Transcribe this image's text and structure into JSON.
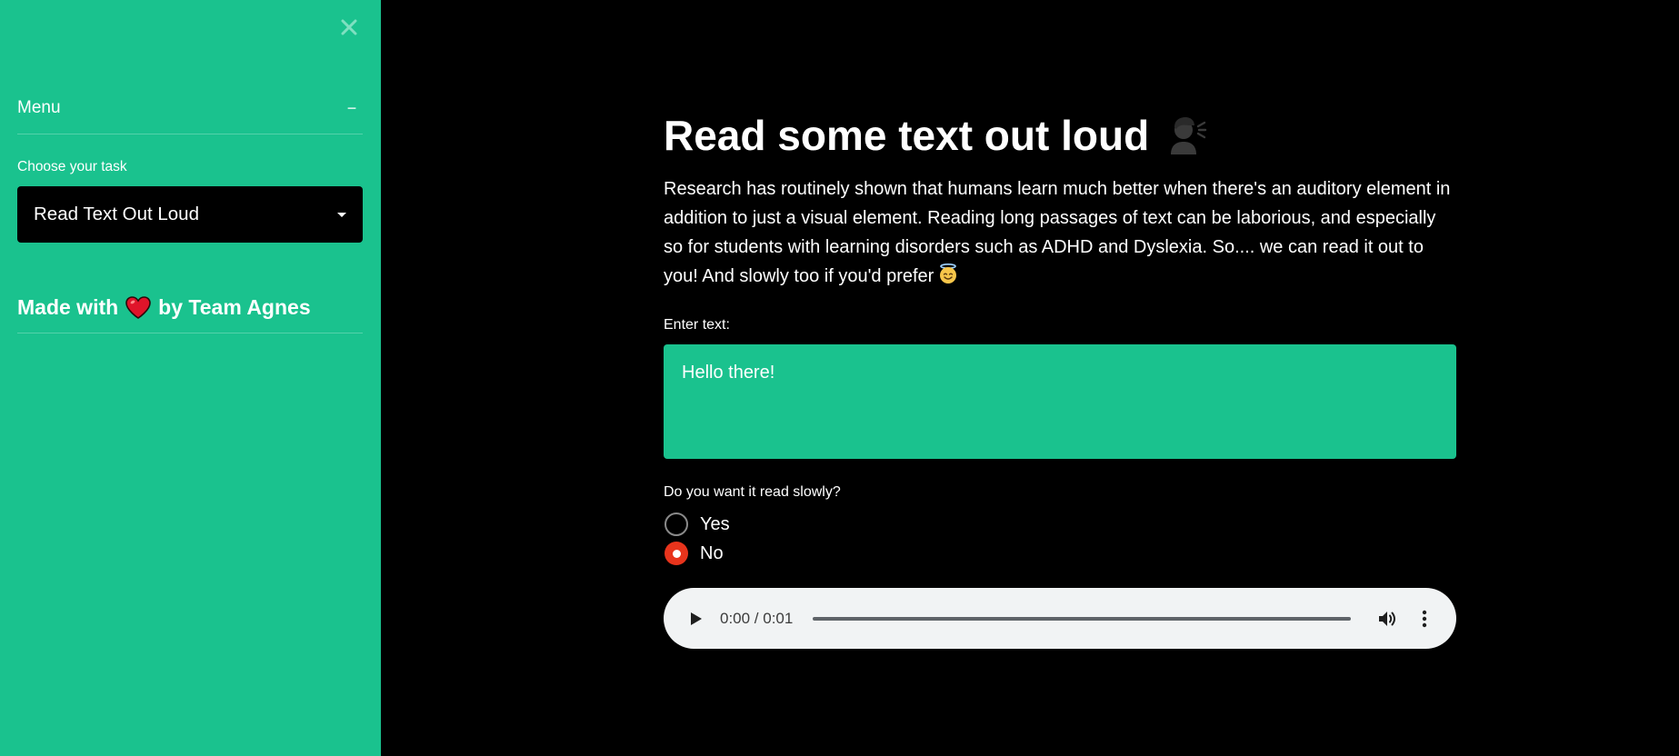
{
  "colors": {
    "sidebar_bg": "#1ac28e",
    "main_bg": "#000000",
    "radio_selected": "#e8341c",
    "audio_bg": "#f1f3f4"
  },
  "sidebar": {
    "close_icon": "close-icon",
    "menu_title": "Menu",
    "menu_toggle": "−",
    "select_label": "Choose your task",
    "select_value": "Read Text Out Loud",
    "made_with_prefix": "Made with",
    "made_with_suffix": "by Team Agnes",
    "heart_icon": "heart-icon"
  },
  "main": {
    "title": "Read some text out loud",
    "title_icon": "speaking-head-icon",
    "description": "Research has routinely shown that humans learn much better when there's an auditory element in addition to just a visual element. Reading long passages of text can be laborious, and especially so for students with learning disorders such as ADHD and Dyslexia. So.... we can read it out to you! And slowly too if you'd prefer",
    "description_icon": "smiling-halo-face-icon",
    "text_label": "Enter text:",
    "text_value": "Hello there!",
    "radio_label": "Do you want it read slowly?",
    "radio_options": [
      {
        "label": "Yes",
        "checked": false
      },
      {
        "label": "No",
        "checked": true
      }
    ],
    "audio": {
      "time": "0:00 / 0:01",
      "progress": 0
    }
  }
}
